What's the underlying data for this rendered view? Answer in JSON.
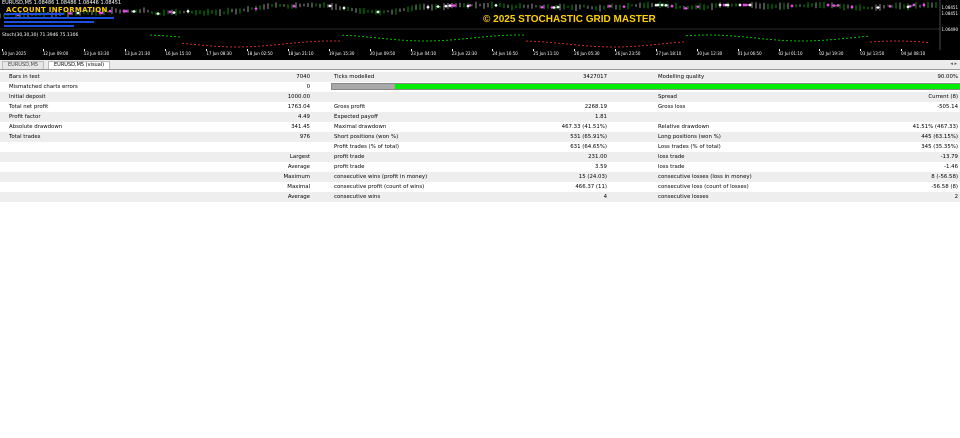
{
  "chart": {
    "symbol_info": "EURUSD,M5  1.08486 1.08486 1.08446 1.08451",
    "account_info": "ACCOUNT INFORMATION",
    "copyright": "© 2025 STOCHASTIC GRID MASTER",
    "indicator_info": "Stoch(30,30,30)  71.3946  75.1306",
    "price_labels": [
      "1.08451",
      "1.08451",
      "1.06490"
    ],
    "time_labels": [
      "10 Jun 2025",
      "12 Jun 09:00",
      "13 Jun 03:30",
      "13 Jun 21:30",
      "16 Jun 15:10",
      "17 Jun 08:30",
      "18 Jun 02:50",
      "18 Jun 21:10",
      "19 Jun 15:30",
      "20 Jun 09:50",
      "23 Jun 04:10",
      "23 Jun 22:30",
      "24 Jun 16:50",
      "25 Jun 11:10",
      "26 Jun 05:30",
      "26 Jun 23:50",
      "27 Jun 18:10",
      "30 Jun 12:30",
      "01 Jul 06:50",
      "02 Jul 01:10",
      "02 Jul 19:30",
      "03 Jul 13:50",
      "04 Jul 08:10"
    ],
    "colors": {
      "background": "#000000",
      "candles_up": "#00c000",
      "markers": "#ffffff"
    }
  },
  "tabs": [
    {
      "label": "EURUSD,M5"
    },
    {
      "label": "EURUSD,M5 (visual)"
    }
  ],
  "report": {
    "bars_in_test": {
      "label": "Bars in test",
      "value": "7040"
    },
    "ticks_modelled": {
      "label": "Ticks modelled",
      "value": "3427017"
    },
    "modelling_quality": {
      "label": "Modelling quality",
      "value": "90.00%",
      "fraction": 0.9
    },
    "mismatched": {
      "label": "Mismatched charts errors",
      "value": "0"
    },
    "initial_deposit": {
      "label": "Initial deposit",
      "value": "1000.00"
    },
    "spread": {
      "label": "Spread",
      "value": "Current (8)"
    },
    "total_net_profit": {
      "label": "Total net profit",
      "value": "1763.04"
    },
    "gross_profit": {
      "label": "Gross profit",
      "value": "2268.19"
    },
    "gross_loss": {
      "label": "Gross loss",
      "value": "-505.14"
    },
    "profit_factor": {
      "label": "Profit factor",
      "value": "4.49"
    },
    "expected_payoff": {
      "label": "Expected payoff",
      "value": "1.81"
    },
    "absolute_drawdown": {
      "label": "Absolute drawdown",
      "value": "341.45"
    },
    "maximal_drawdown": {
      "label": "Maximal drawdown",
      "value": "467.33 (41.51%)"
    },
    "relative_drawdown": {
      "label": "Relative drawdown",
      "value": "41.51% (467.33)"
    },
    "total_trades": {
      "label": "Total trades",
      "value": "976"
    },
    "short_positions": {
      "label": "Short positions (won %)",
      "value": "531 (65.91%)"
    },
    "long_positions": {
      "label": "Long positions (won %)",
      "value": "445 (63.15%)"
    },
    "profit_trades": {
      "label": "Profit trades (% of total)",
      "value": "631 (64.65%)"
    },
    "loss_trades": {
      "label": "Loss trades (% of total)",
      "value": "345 (35.35%)"
    },
    "largest": {
      "label": "Largest",
      "profit_label": "profit trade",
      "profit_value": "231.00",
      "loss_label": "loss trade",
      "loss_value": "-13.79"
    },
    "average": {
      "label": "Average",
      "profit_label": "profit trade",
      "profit_value": "3.59",
      "loss_label": "loss trade",
      "loss_value": "-1.46"
    },
    "maximum": {
      "label": "Maximum",
      "wins_label": "consecutive wins (profit in money)",
      "wins_value": "15 (24.03)",
      "losses_label": "consecutive losses (loss in money)",
      "losses_value": "8 (-56.58)"
    },
    "maximal": {
      "label": "Maximal",
      "profit_label": "consecutive profit (count of wins)",
      "profit_value": "466.37 (11)",
      "loss_label": "consecutive loss (count of losses)",
      "loss_value": "-56.58 (8)"
    },
    "average_consec": {
      "label": "Average",
      "wins_label": "consecutive wins",
      "wins_value": "4",
      "losses_label": "consecutive losses",
      "losses_value": "2"
    }
  }
}
